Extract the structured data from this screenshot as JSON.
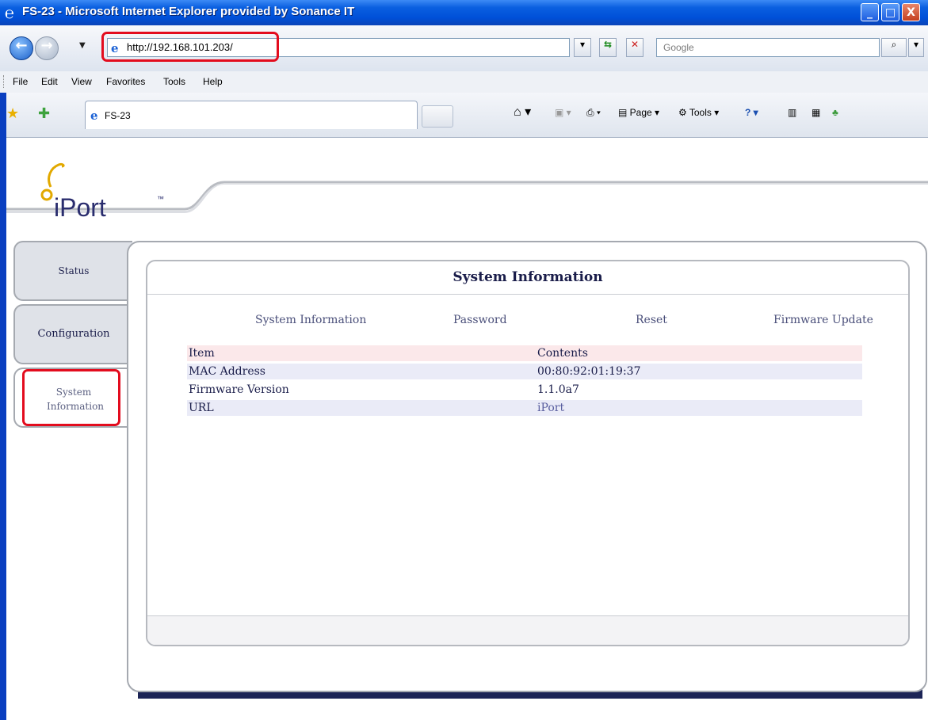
{
  "window": {
    "title": "FS-23 - Microsoft Internet Explorer provided by Sonance IT",
    "controls": {
      "minimize": "_",
      "maximize": "□",
      "close": "X"
    }
  },
  "address_bar": {
    "url": "http://192.168.101.203/",
    "search_placeholder": "Google"
  },
  "menu": [
    "File",
    "Edit",
    "View",
    "Favorites",
    "Tools",
    "Help"
  ],
  "tab": {
    "label": "FS-23"
  },
  "command_bar": {
    "page_label": "Page",
    "tools_label": "Tools"
  },
  "site": {
    "logo_text": "iPort",
    "logo_mark": "™",
    "side_tabs": [
      "Status",
      "Configuration",
      "System Information"
    ],
    "panel_title": "System Information",
    "sub_links": [
      "System Information",
      "Password",
      "Reset",
      "Firmware Update"
    ],
    "table": {
      "headers": [
        "Item",
        "Contents"
      ],
      "rows": [
        [
          "MAC Address",
          "00:80:92:01:19:37"
        ],
        [
          "Firmware Version",
          "1.1.0a7"
        ],
        [
          "URL",
          "iPort"
        ]
      ]
    }
  },
  "colors": {
    "highlight": "#e30c1e",
    "navy": "#1c2456",
    "text": "#1a1d4a"
  }
}
